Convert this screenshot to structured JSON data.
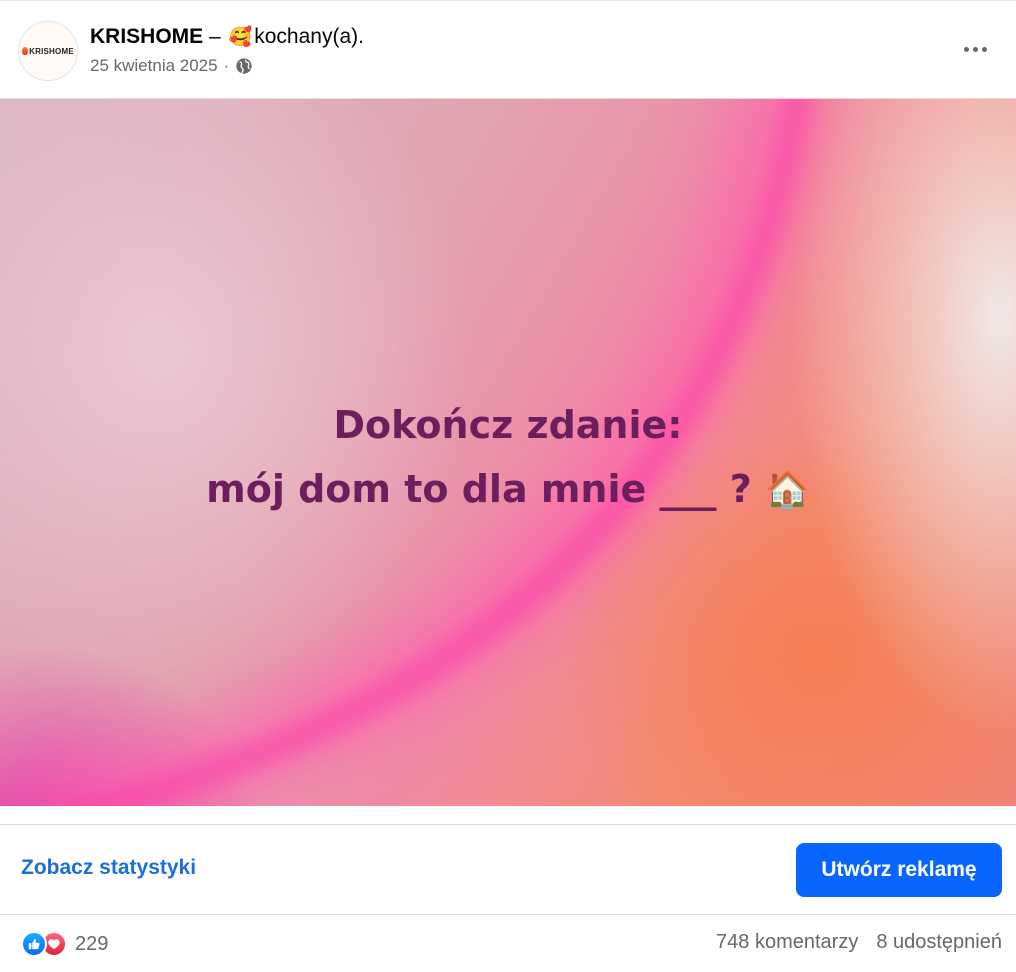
{
  "post": {
    "page_name": "KRISHOME",
    "separator": "–",
    "feeling_emoji": "🥰",
    "feeling_text": "kochany(a).",
    "date": "25 kwietnia 2025",
    "dot": "·",
    "privacy_icon": "globe-icon",
    "more_icon": "more-options-icon",
    "avatar_logo_text": "KRISHOME"
  },
  "image": {
    "line1": "Dokończ zdanie:",
    "line2": "mój dom to dla mnie ___ ?",
    "house_emoji": "🏠",
    "text_color": "#6c1f5c"
  },
  "actions": {
    "stats_link": "Zobacz statystyki",
    "create_ad": "Utwórz reklamę",
    "accent": "#0866ff"
  },
  "engagement": {
    "reaction_icons": [
      "like-icon",
      "love-icon"
    ],
    "reaction_count": "229",
    "comments": "748 komentarzy",
    "shares": "8 udostępnień"
  }
}
